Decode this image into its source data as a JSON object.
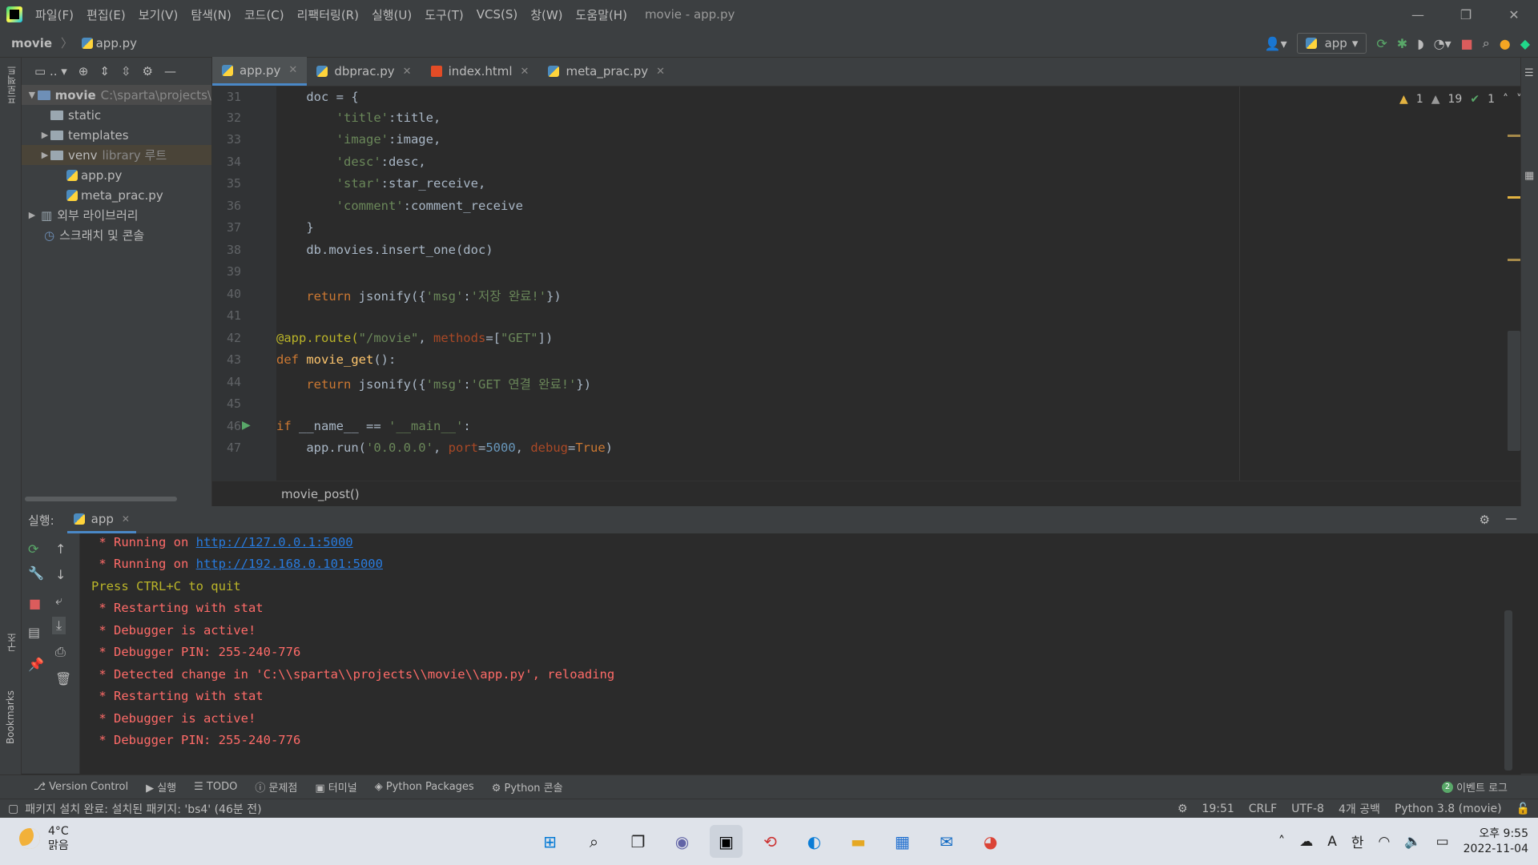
{
  "menubar": {
    "items": [
      "파일(F)",
      "편집(E)",
      "보기(V)",
      "탐색(N)",
      "코드(C)",
      "리팩터링(R)",
      "실행(U)",
      "도구(T)",
      "VCS(S)",
      "창(W)",
      "도움말(H)"
    ],
    "window_title": "movie - app.py"
  },
  "navbar": {
    "project": "movie",
    "file": "app.py",
    "run_config": "app"
  },
  "left_strip": {
    "project_label": "프로젝트",
    "structure_label": "구조",
    "bookmarks_label": "Bookmarks"
  },
  "project_tree": {
    "root_name": "movie",
    "root_path": "C:\\sparta\\projects\\",
    "items": [
      {
        "name": "static"
      },
      {
        "name": "templates"
      },
      {
        "name": "venv",
        "hint": "library 루트"
      },
      {
        "name": "app.py"
      },
      {
        "name": "meta_prac.py"
      }
    ],
    "external_libs": "외부 라이브러리",
    "scratches": "스크래치 및 콘솔"
  },
  "editor_tabs": [
    {
      "label": "app.py"
    },
    {
      "label": "dbprac.py"
    },
    {
      "label": "index.html"
    },
    {
      "label": "meta_prac.py"
    }
  ],
  "inspections": {
    "warn1": "1",
    "warn2": "19",
    "ok": "1"
  },
  "code": {
    "line_numbers": [
      "31",
      "32",
      "33",
      "34",
      "35",
      "36",
      "37",
      "38",
      "39",
      "40",
      "41",
      "42",
      "43",
      "44",
      "45",
      "46",
      "47"
    ],
    "l31a": "    doc = {",
    "l32k": "'title'",
    "l32v": ":title,",
    "l33k": "'image'",
    "l33v": ":image,",
    "l34k": "'desc'",
    "l34v": ":desc,",
    "l35k": "'star'",
    "l35v": ":star_receive,",
    "l36k": "'comment'",
    "l36v": ":comment_receive",
    "l37": "    }",
    "l38": "    db.movies.insert_one(doc)",
    "l40a": "    ",
    "l40kw": "return",
    "l40b": " jsonify({",
    "l40s1": "'msg'",
    "l40c": ":",
    "l40s2": "'저장 완료!'",
    "l40d": "})",
    "l42dec": "@app.route(",
    "l42s": "\"/movie\"",
    "l42c": ", ",
    "l42p": "methods",
    "l42e": "=[",
    "l42s2": "\"GET\"",
    "l42f": "])",
    "l43kw": "def",
    "l43fn": " movie_get",
    "l43b": "():",
    "l44a": "    ",
    "l44kw": "return",
    "l44b": " jsonify({",
    "l44s1": "'msg'",
    "l44c": ":",
    "l44s2": "'GET 연결 완료!'",
    "l44d": "})",
    "l46kw": "if",
    "l46a": " __name__ == ",
    "l46s": "'__main__'",
    "l46b": ":",
    "l47a": "    app.run(",
    "l47s": "'0.0.0.0'",
    "l47b": ", ",
    "l47p1": "port",
    "l47c": "=",
    "l47n": "5000",
    "l47d": ", ",
    "l47p2": "debug",
    "l47e": "=",
    "l47kw": "True",
    "l47f": ")"
  },
  "editor_breadcrumb": "movie_post()",
  "run": {
    "label": "실행:",
    "tab": "app",
    "lines": [
      {
        "pre": " * Running on ",
        "link": "http://127.0.0.1:5000"
      },
      {
        "pre": " * Running on ",
        "link": "http://192.168.0.101:5000"
      },
      {
        "text": "Press CTRL+C to quit"
      },
      {
        "text": " * Restarting with stat"
      },
      {
        "text": " * Debugger is active!"
      },
      {
        "text": " * Debugger PIN: 255-240-776"
      },
      {
        "text": " * Detected change in 'C:\\\\sparta\\\\projects\\\\movie\\\\app.py', reloading"
      },
      {
        "text": " * Restarting with stat"
      },
      {
        "text": " * Debugger is active!"
      },
      {
        "text": " * Debugger PIN: 255-240-776"
      }
    ]
  },
  "toolwindows": [
    "Version Control",
    "실행",
    "TODO",
    "문제점",
    "터미널",
    "Python Packages",
    "Python 콘솔"
  ],
  "event_log": {
    "count": "2",
    "label": "이벤트 로그"
  },
  "status": {
    "message": "패키지 설치 완료: 설치된 패키지: 'bs4' (46분 전)",
    "position": "19:51",
    "line_sep": "CRLF",
    "encoding": "UTF-8",
    "indent": "4개 공백",
    "interpreter": "Python 3.8 (movie)"
  },
  "taskbar": {
    "temp": "4°C",
    "weather": "맑음",
    "ime": "한",
    "time": "오후 9:55",
    "date": "2022-11-04"
  }
}
